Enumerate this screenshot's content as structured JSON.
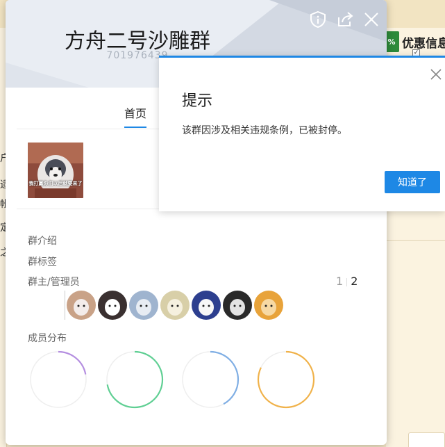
{
  "background": {
    "promo_badge": "%",
    "promo_text": "优惠信息",
    "checkbox_mark": "✓",
    "left_text": [
      "户",
      "适",
      "帐",
      "定",
      "之"
    ]
  },
  "group": {
    "name": "方舟二号沙雕群",
    "id": "701976439",
    "tabs": [
      {
        "label": "首页",
        "active": true
      }
    ],
    "album": {
      "caption": "我打赢你们以后就要来了"
    },
    "intro_label": "群介绍",
    "tags_label": "群标签",
    "admins_label": "群主/管理员",
    "pager": {
      "prev": "1",
      "current": "2"
    },
    "member_dist_label": "成员分布",
    "rings": [
      {
        "color": "#b48ee0",
        "fraction": 0.22
      },
      {
        "color": "#5fcf93",
        "fraction": 0.72
      },
      {
        "color": "#7faee4",
        "fraction": 0.42
      },
      {
        "color": "#f0b24a",
        "fraction": 0.82
      }
    ],
    "avatars": [
      {
        "name": "avatar-dog",
        "bg": "#c9a287",
        "fg": "#f3ecea"
      },
      {
        "name": "avatar-marshmello",
        "bg": "#3a3030",
        "fg": "#ffffff"
      },
      {
        "name": "avatar-anime-boy",
        "bg": "#9fb4cf",
        "fg": "#e7ecf3"
      },
      {
        "name": "avatar-anime-girl",
        "bg": "#d8cfa8",
        "fg": "#f5f0df"
      },
      {
        "name": "avatar-cartoon-boy",
        "bg": "#2d3f8f",
        "fg": "#f7f7f7"
      },
      {
        "name": "avatar-dark-hair",
        "bg": "#2a2a2a",
        "fg": "#e3e3e3"
      },
      {
        "name": "avatar-monkey",
        "bg": "#e8a33a",
        "fg": "#f7d9a3"
      }
    ]
  },
  "dialog": {
    "title": "提示",
    "message": "该群因涉及相关违规条例，已被封停。",
    "button_label": "知道了"
  },
  "colors": {
    "accent": "#1e88e5",
    "header_bg": "#e9edf3"
  }
}
